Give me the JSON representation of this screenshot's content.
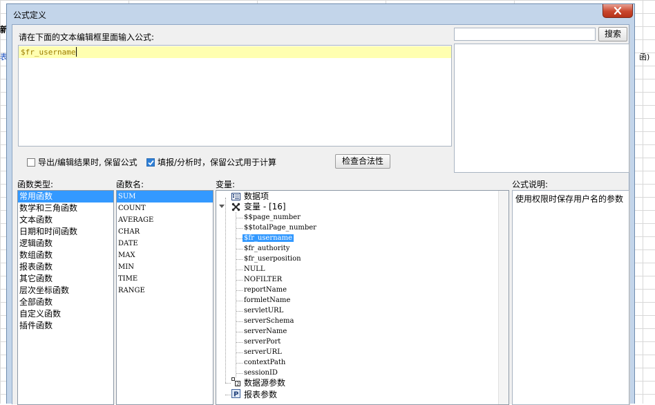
{
  "background": {
    "bold_text": "新",
    "link_text": "表",
    "right_text": "函)"
  },
  "dialog": {
    "title": "公式定义"
  },
  "editor": {
    "prompt": "请在下面的文本编辑框里面输入公式:",
    "content": "$fr_username"
  },
  "search": {
    "value": "",
    "button": "搜索"
  },
  "options": {
    "keep_formula_export": "导出/编辑结果时, 保留公式",
    "keep_formula_export_checked": false,
    "keep_formula_fill": "填报/分析时，保留公式用于计算",
    "keep_formula_fill_checked": true,
    "check_button": "检查合法性"
  },
  "function_types": {
    "header": "函数类型:",
    "items": [
      "常用函数",
      "数学和三角函数",
      "文本函数",
      "日期和时间函数",
      "逻辑函数",
      "数组函数",
      "报表函数",
      "其它函数",
      "层次坐标函数",
      "全部函数",
      "自定义函数",
      "插件函数"
    ],
    "selected": "常用函数"
  },
  "function_names": {
    "header": "函数名:",
    "items": [
      "SUM",
      "COUNT",
      "AVERAGE",
      "CHAR",
      "DATE",
      "MAX",
      "MIN",
      "TIME",
      "RANGE"
    ],
    "selected": "SUM"
  },
  "variables": {
    "header": "变量:",
    "tree": {
      "data_item": "数据项",
      "variable_group": "变量 - [16]",
      "leaves": [
        "$$page_number",
        "$$totalPage_number",
        "$fr_username",
        "$fr_authority",
        "$fr_userposition",
        "NULL",
        "NOFILTER",
        "reportName",
        "formletName",
        "servletURL",
        "serverSchema",
        "serverName",
        "serverPort",
        "serverURL",
        "contextPath",
        "sessionID"
      ],
      "selected": "$fr_username",
      "datasource_params": "数据源参数",
      "report_params": "报表参数"
    }
  },
  "description": {
    "header": "公式说明:",
    "text": "使用权限时保存用户名的参数"
  },
  "colors": {
    "selection": "#3399ff",
    "editor_highlight": "#ffffb0",
    "formula_text": "#9c7b00"
  }
}
